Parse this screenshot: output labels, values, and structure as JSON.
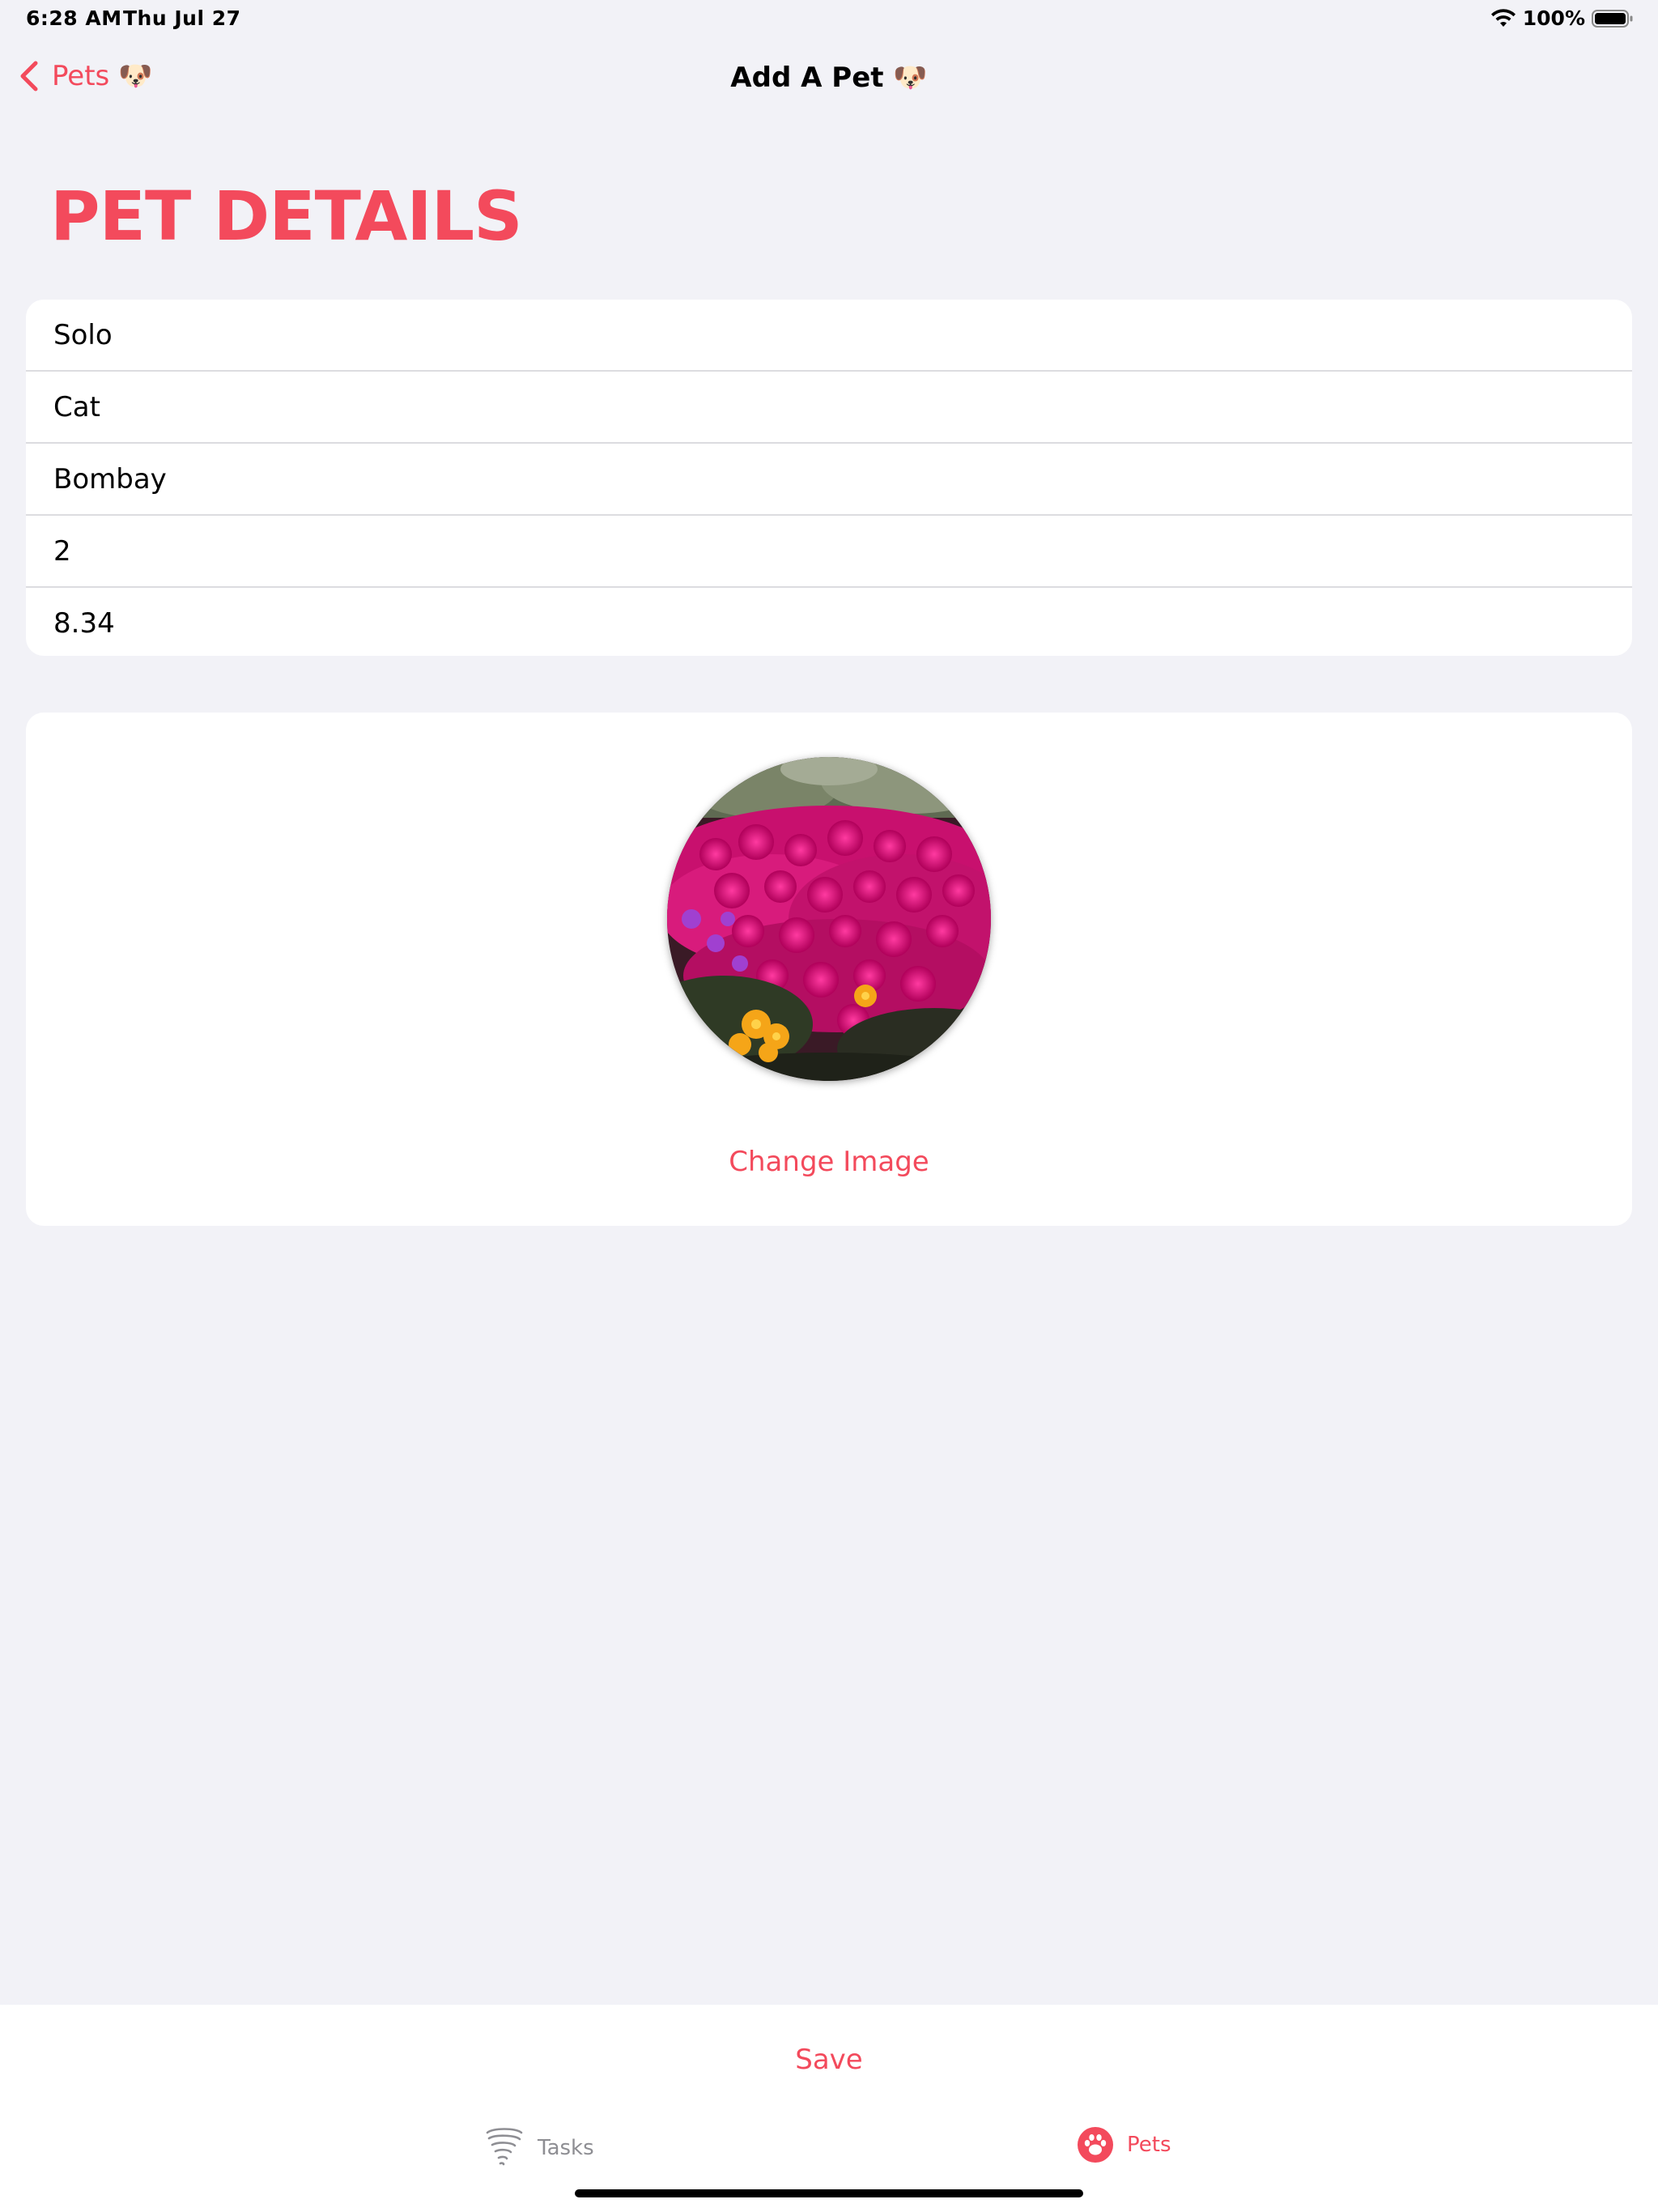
{
  "status_bar": {
    "time": "6:28 AM",
    "date": "Thu Jul 27",
    "battery": "100%"
  },
  "nav": {
    "back_label": "Pets 🐶",
    "title": "Add A Pet 🐶"
  },
  "section": {
    "heading": "PET DETAILS"
  },
  "form": {
    "fields": [
      {
        "value": "Solo"
      },
      {
        "value": "Cat"
      },
      {
        "value": "Bombay"
      },
      {
        "value": "2"
      },
      {
        "value": "8.34"
      }
    ]
  },
  "image_card": {
    "change_label": "Change Image"
  },
  "toolbar": {
    "save_label": "Save"
  },
  "tabs": [
    {
      "label": "Tasks",
      "icon": "tornado-icon",
      "selected": false
    },
    {
      "label": "Pets",
      "icon": "paw-icon",
      "selected": true
    }
  ],
  "colors": {
    "accent": "#f34a5c",
    "background": "#f2f2f7",
    "card": "#ffffff",
    "inactive_tab": "#8e8e93"
  }
}
